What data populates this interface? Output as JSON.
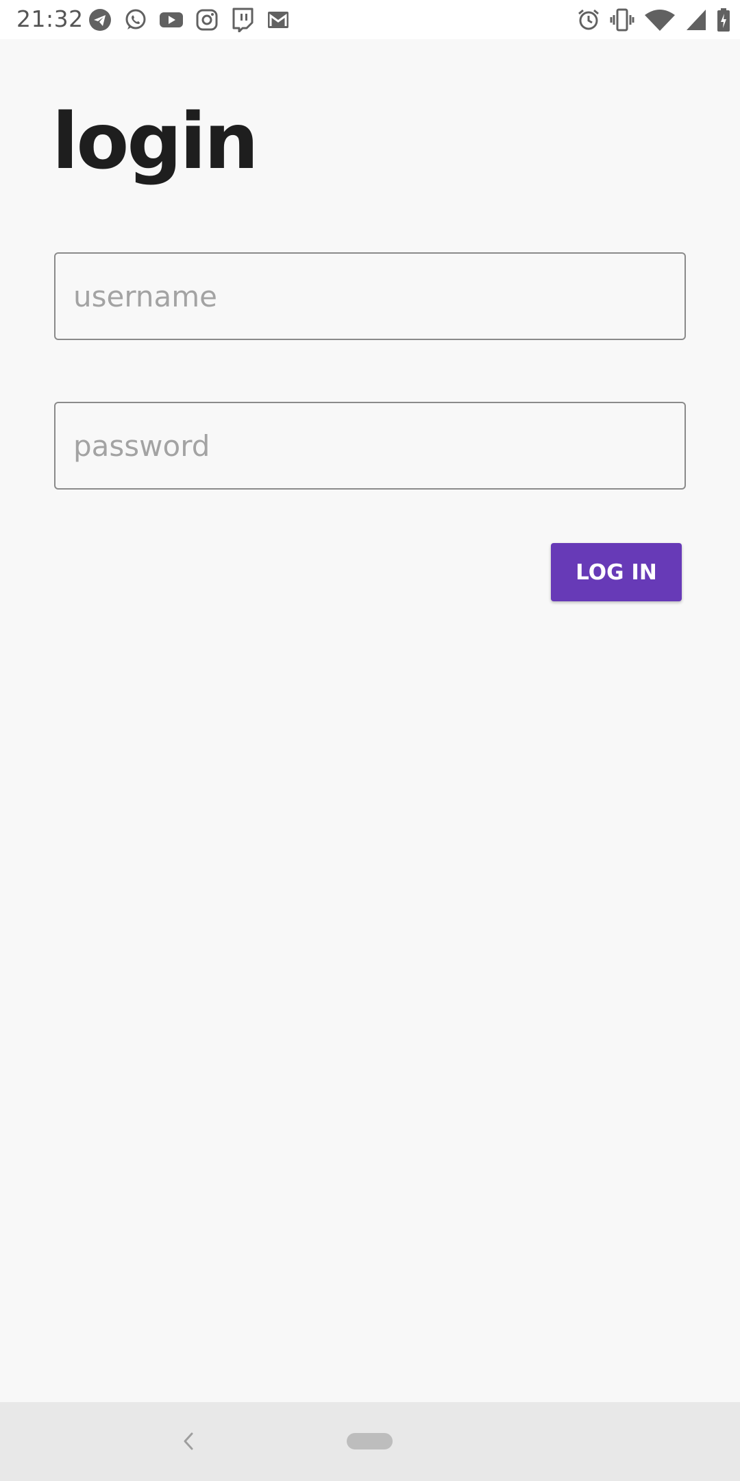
{
  "status_bar": {
    "time": "21:32",
    "notification_icons": [
      "telegram-icon",
      "whatsapp-icon",
      "youtube-icon",
      "instagram-icon",
      "twitch-icon",
      "gmail-icon"
    ],
    "system_icons": [
      "alarm-icon",
      "vibrate-icon",
      "wifi-icon",
      "cell-signal-icon",
      "battery-charging-icon"
    ]
  },
  "login": {
    "title": "login",
    "username_placeholder": "username",
    "username_value": "",
    "password_placeholder": "password",
    "password_value": "",
    "submit_label": "LOG IN"
  },
  "colors": {
    "accent": "#673ab7",
    "background": "#f8f8f8",
    "title_text": "#1e1e1e",
    "nav_bar": "#e8e8e8"
  }
}
